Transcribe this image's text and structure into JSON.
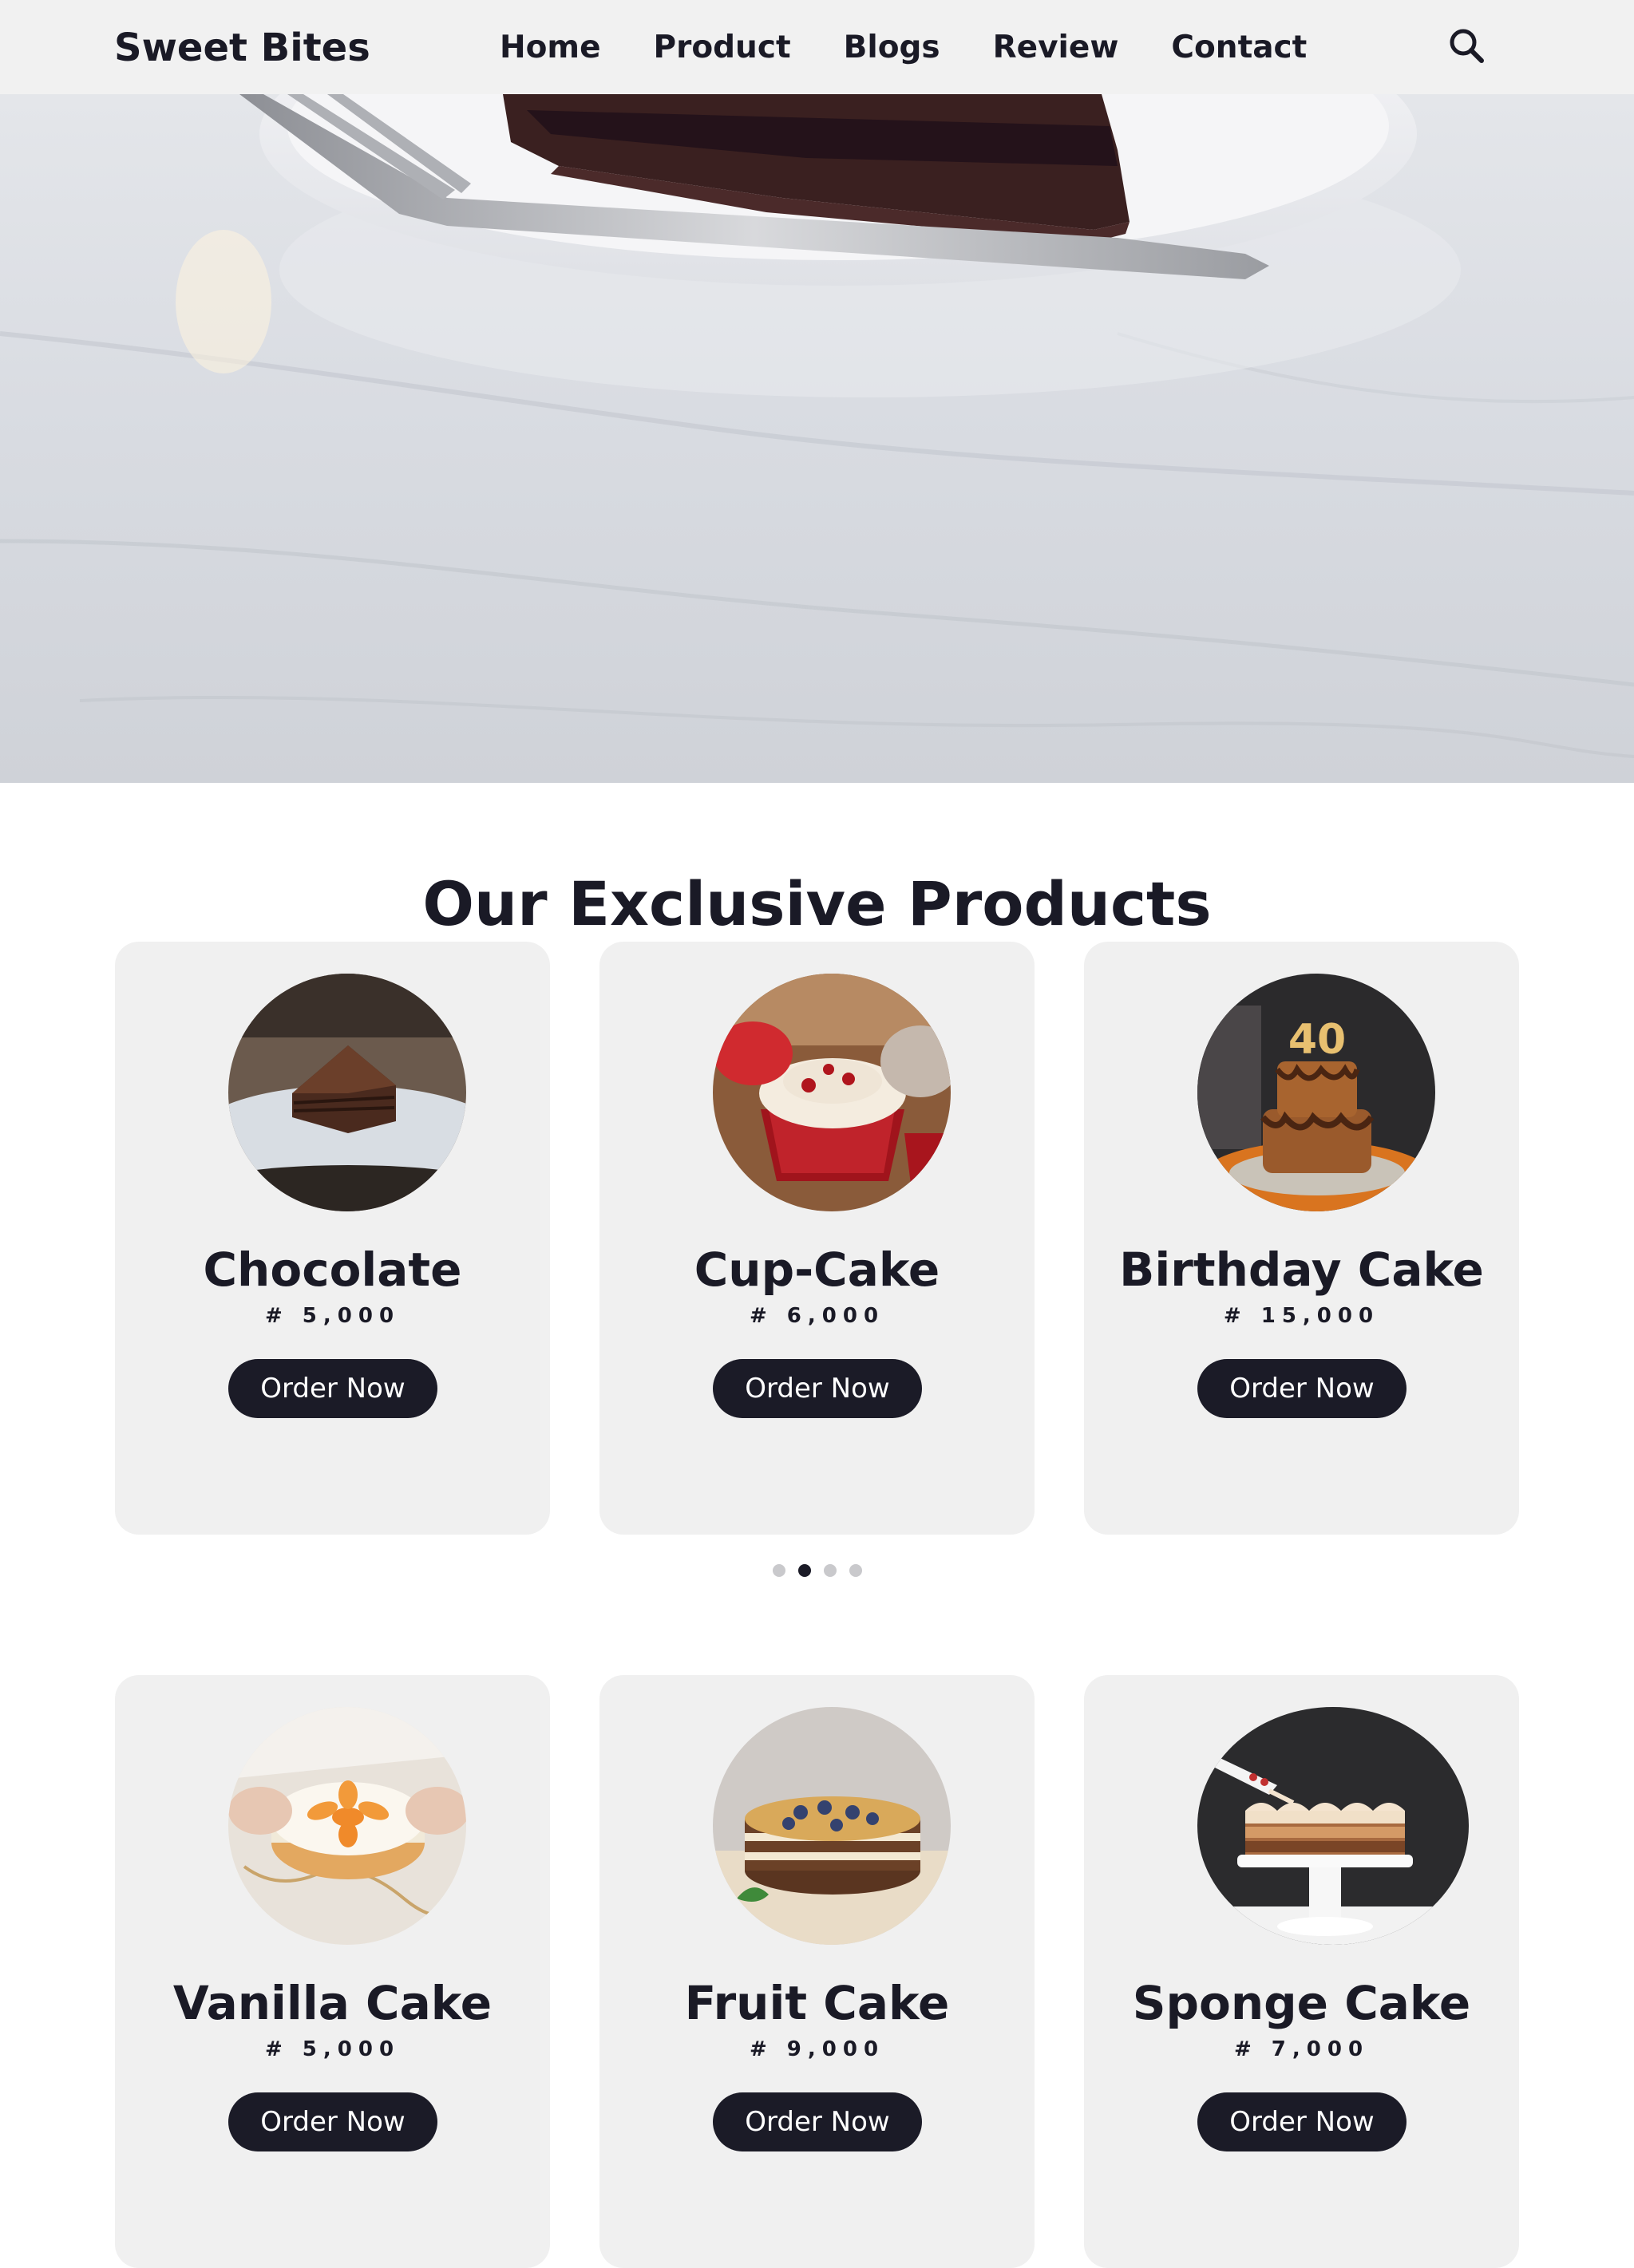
{
  "brand": "Sweet Bites",
  "nav": {
    "links": [
      "Home",
      "Product",
      "Blogs",
      "Review",
      "Contact"
    ],
    "search_icon": "search-icon"
  },
  "hero": {
    "image": "chocolate-cake-slice-on-white-plate-with-fork"
  },
  "products": {
    "title": "Our Exclusive Products",
    "slider": {
      "pages": 4,
      "active": 2
    },
    "items": [
      {
        "name": "Chocolate",
        "price": "# 5,000",
        "button": "Order Now",
        "image": "chocolate-cake-slice"
      },
      {
        "name": "Cup-Cake",
        "price": "# 6,000",
        "button": "Order Now",
        "image": "red-velvet-cupcakes"
      },
      {
        "name": "Birthday Cake",
        "price": "# 15,000",
        "button": "Order Now",
        "image": "birthday-cake-40"
      },
      {
        "name": "Vanilla Cake",
        "price": "# 5,000",
        "button": "Order Now",
        "image": "vanilla-peach-cake"
      },
      {
        "name": "Fruit Cake",
        "price": "# 9,000",
        "button": "Order Now",
        "image": "blueberry-layer-cake"
      },
      {
        "name": "Sponge Cake",
        "price": "# 7,000",
        "button": "Order Now",
        "image": "sponge-cake-on-stand"
      }
    ]
  },
  "colors": {
    "accent": "#1b1b27",
    "navbar_bg": "#f1f1f1",
    "card_bg": "#f0f0f0",
    "text": "#1a1a26"
  }
}
